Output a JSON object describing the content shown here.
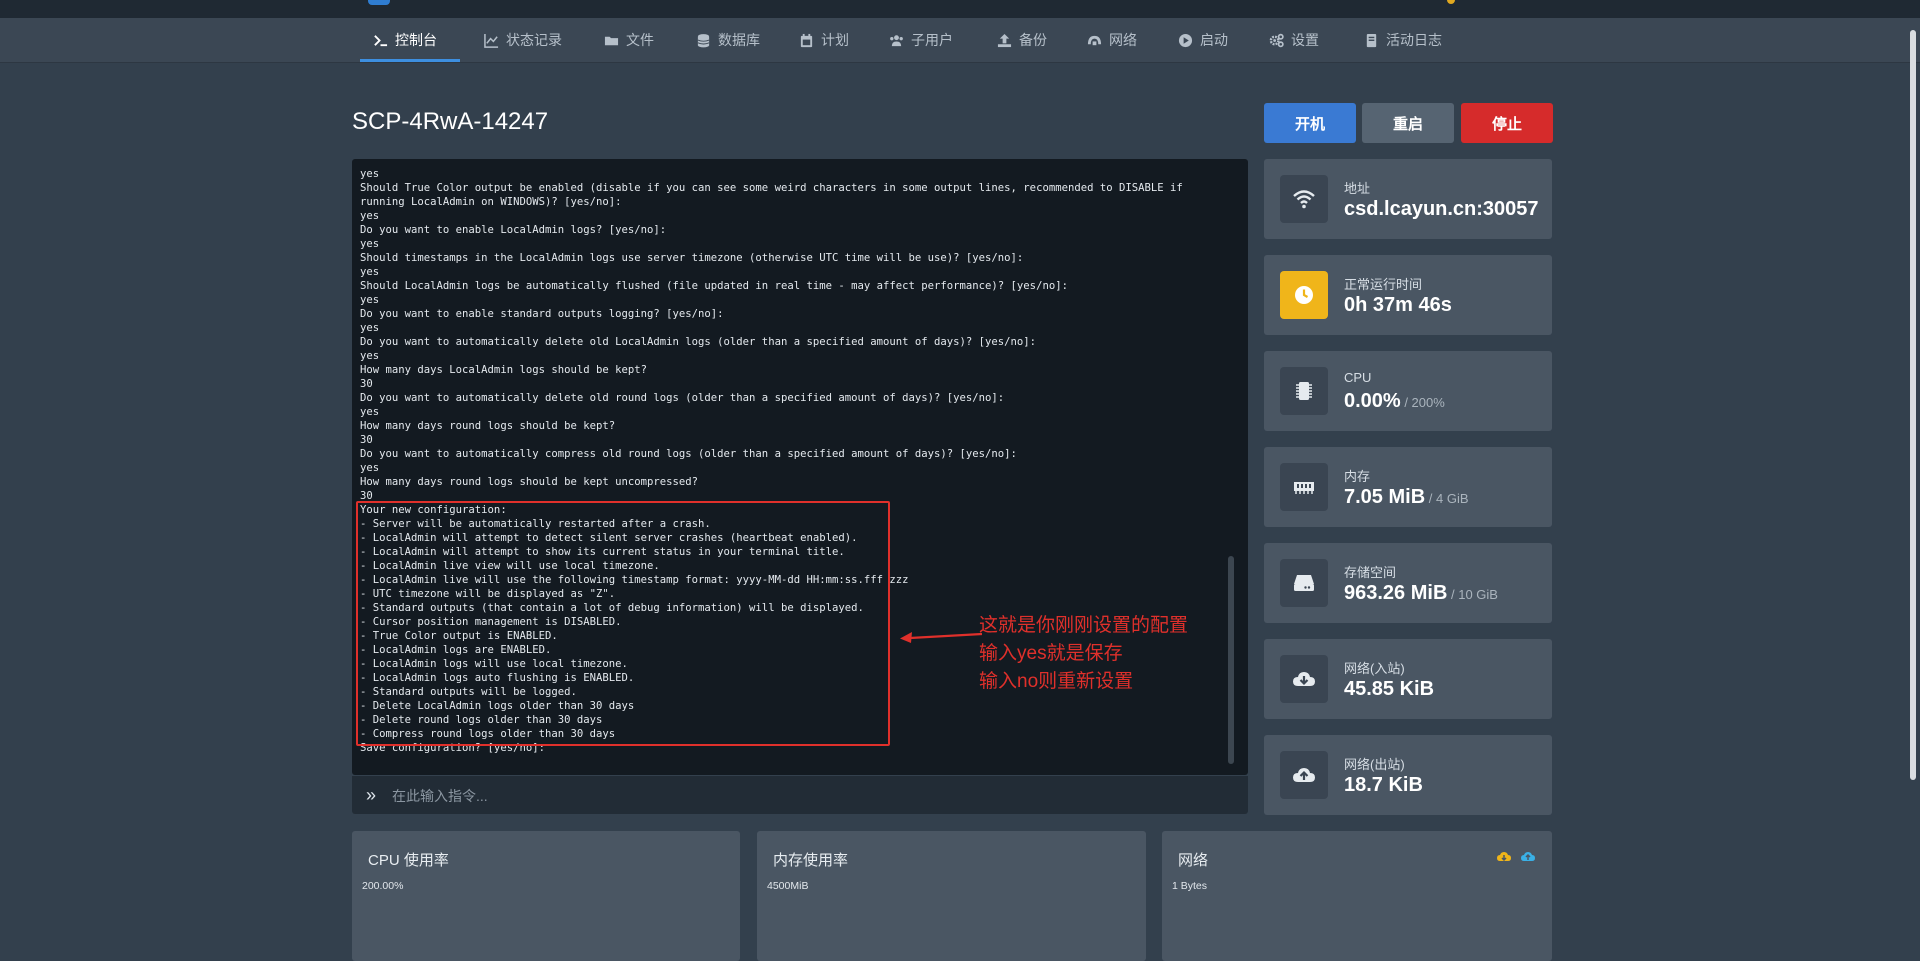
{
  "nav": {
    "items": [
      {
        "label": "控制台",
        "icon": "terminal-icon",
        "active": true
      },
      {
        "label": "状态记录",
        "icon": "chart-line-icon"
      },
      {
        "label": "文件",
        "icon": "folder-icon"
      },
      {
        "label": "数据库",
        "icon": "database-icon"
      },
      {
        "label": "计划",
        "icon": "calendar-icon"
      },
      {
        "label": "子用户",
        "icon": "users-icon"
      },
      {
        "label": "备份",
        "icon": "upload-icon"
      },
      {
        "label": "网络",
        "icon": "network-icon"
      },
      {
        "label": "启动",
        "icon": "play-circle-icon"
      },
      {
        "label": "设置",
        "icon": "cogs-icon"
      },
      {
        "label": "活动日志",
        "icon": "book-icon"
      }
    ]
  },
  "server": {
    "name": "SCP-4RwA-14247"
  },
  "controls": {
    "start": "开机",
    "restart": "重启",
    "stop": "停止"
  },
  "console": {
    "lines": [
      "yes",
      "Should True Color output be enabled (disable if you can see some weird characters in some output lines, recommended to DISABLE if running LocalAdmin on WINDOWS)? [yes/no]:",
      "yes",
      "Do you want to enable LocalAdmin logs? [yes/no]:",
      "yes",
      "Should timestamps in the LocalAdmin logs use server timezone (otherwise UTC time will be use)? [yes/no]:",
      "yes",
      "Should LocalAdmin logs be automatically flushed (file updated in real time - may affect performance)? [yes/no]:",
      "yes",
      "Do you want to enable standard outputs logging? [yes/no]:",
      "yes",
      "Do you want to automatically delete old LocalAdmin logs (older than a specified amount of days)? [yes/no]:",
      "yes",
      "How many days LocalAdmin logs should be kept?",
      "30",
      "Do you want to automatically delete old round logs (older than a specified amount of days)? [yes/no]:",
      "yes",
      "How many days round logs should be kept?",
      "30",
      "Do you want to automatically compress old round logs (older than a specified amount of days)? [yes/no]:",
      "yes",
      "How many days round logs should be kept uncompressed?",
      "30",
      "Your new configuration:",
      "- Server will be automatically restarted after a crash.",
      "- LocalAdmin will attempt to detect silent server crashes (heartbeat enabled).",
      "- LocalAdmin will attempt to show its current status in your terminal title.",
      "- LocalAdmin live view will use local timezone.",
      "- LocalAdmin live will use the following timestamp format: yyyy-MM-dd HH:mm:ss.fff zzz",
      "- UTC timezone will be displayed as \"Z\".",
      "- Standard outputs (that contain a lot of debug information) will be displayed.",
      "- Cursor position management is DISABLED.",
      "- True Color output is ENABLED.",
      "- LocalAdmin logs are ENABLED.",
      "- LocalAdmin logs will use local timezone.",
      "- LocalAdmin logs auto flushing is ENABLED.",
      "- Standard outputs will be logged.",
      "- Delete LocalAdmin logs older than 30 days",
      "- Delete round logs older than 30 days",
      "- Compress round logs older than 30 days",
      "Save configuration? [yes/no]:"
    ],
    "command_placeholder": "在此输入指令..."
  },
  "annotation": {
    "line1": "这就是你刚刚设置的配置",
    "line2": "输入yes就是保存",
    "line3": "输入no则重新设置",
    "color": "#e0302b"
  },
  "stats": [
    {
      "label": "地址",
      "value": "csd.lcayun.cn:30057",
      "sub": "",
      "icon": "wifi-icon"
    },
    {
      "label": "正常运行时间",
      "value": "0h 37m 46s",
      "sub": "",
      "icon": "clock-icon"
    },
    {
      "label": "CPU",
      "value": "0.00%",
      "sub": " / 200%",
      "icon": "cpu-chip-icon"
    },
    {
      "label": "内存",
      "value": "7.05 MiB",
      "sub": " / 4 GiB",
      "icon": "memory-icon"
    },
    {
      "label": "存储空间",
      "value": "963.26 MiB",
      "sub": " / 10 GiB",
      "icon": "hdd-icon"
    },
    {
      "label": "网络(入站)",
      "value": "45.85 KiB",
      "sub": "",
      "icon": "cloud-download-icon"
    },
    {
      "label": "网络(出站)",
      "value": "18.7 KiB",
      "sub": "",
      "icon": "cloud-upload-icon"
    }
  ],
  "charts": {
    "cpu": {
      "title": "CPU 使用率",
      "axis_top": "200.00%"
    },
    "memory": {
      "title": "内存使用率",
      "axis_top": "4500MiB"
    },
    "network": {
      "title": "网络",
      "axis_top": "1 Bytes"
    }
  },
  "colors": {
    "accent": "#3d8fe0",
    "start": "#3a7ad3",
    "restart": "#566472",
    "stop": "#d62b2b",
    "uptime_icon": "#f0b51a"
  }
}
